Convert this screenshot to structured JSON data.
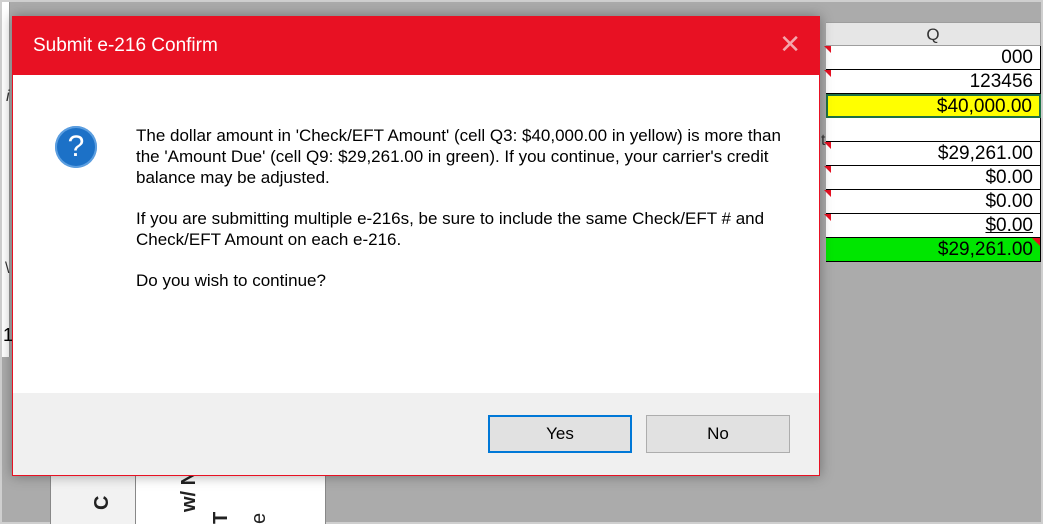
{
  "dialog": {
    "title": "Submit e-216 Confirm",
    "message_1": "The dollar amount in 'Check/EFT Amount' (cell Q3: $40,000.00 in yellow) is more than the 'Amount Due' (cell Q9: $29,261.00 in green). If you continue, your carrier's credit balance may be adjusted.",
    "message_2": "If you are submitting multiple e-216s, be sure to include the same Check/EFT # and Check/EFT Amount on each e-216.",
    "message_3": "Do you wish to continue?",
    "yes_label": "Yes",
    "no_label": "No",
    "icon": "question-icon",
    "accent_color": "#e81123"
  },
  "sheet": {
    "column_header": "Q",
    "cells": [
      "000",
      "123456",
      "$40,000.00",
      "",
      "$29,261.00",
      "$0.00",
      "$0.00",
      "$0.00",
      "$29,261.00"
    ],
    "highlight_yellow": "#ffff00",
    "highlight_green": "#00e600",
    "lower_texts": [
      "C",
      "w/ N",
      "T",
      "e"
    ],
    "left_edge_chars": [
      "i",
      "t",
      "\\",
      "1"
    ]
  }
}
